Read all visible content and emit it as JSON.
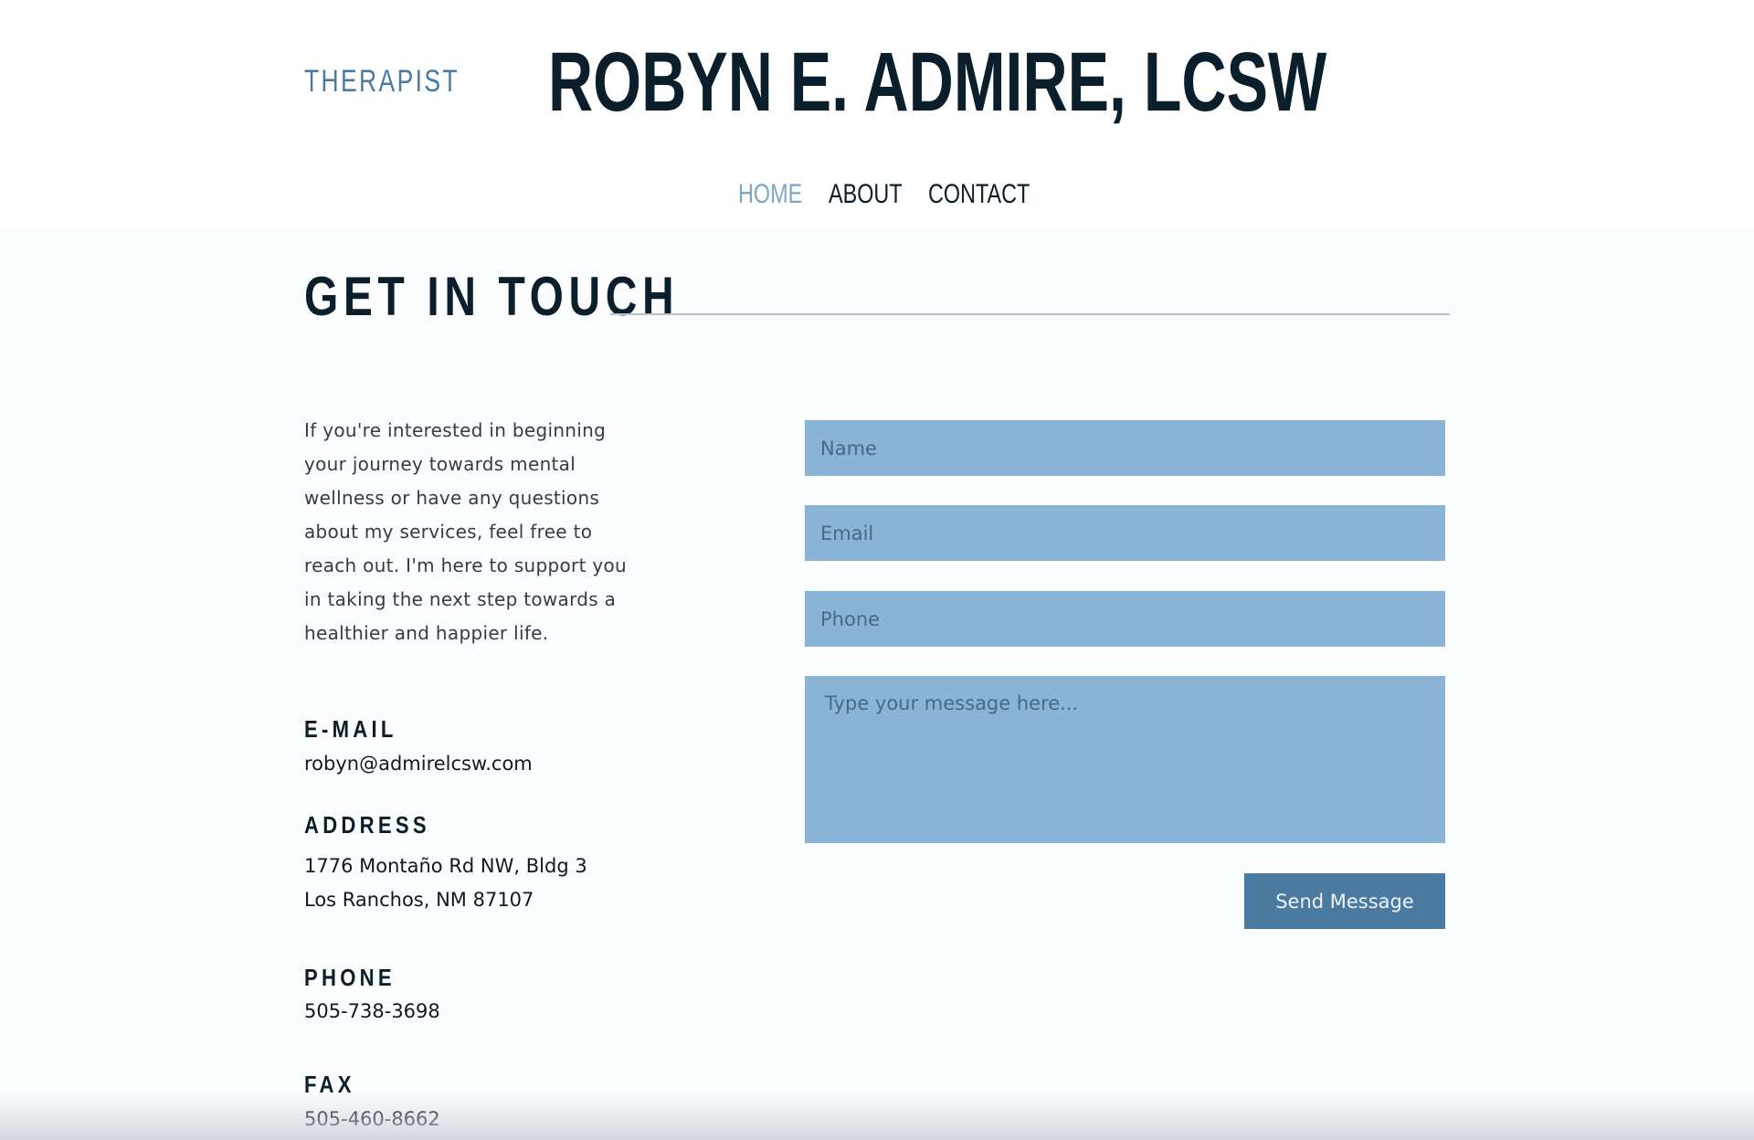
{
  "header": {
    "tagline": "THERAPIST",
    "site_title": "ROBYN E. ADMIRE, LCSW"
  },
  "nav": {
    "items": [
      {
        "label": "HOME",
        "active": true
      },
      {
        "label": "ABOUT",
        "active": false
      },
      {
        "label": "CONTACT",
        "active": false
      }
    ]
  },
  "main": {
    "section_title": "GET IN TOUCH",
    "intro": "If you're interested in beginning your journey towards mental wellness or have any questions about my services, feel free to reach out. I'm here to support you in taking the next step towards a healthier and happier life.",
    "contact_info": {
      "email_label": "E-MAIL",
      "email_value": "robyn@admirelcsw.com",
      "address_label": "ADDRESS",
      "address_line1": "1776 Montaño Rd NW, Bldg 3",
      "address_line2": "Los Ranchos, NM 87107",
      "phone_label": "PHONE",
      "phone_value": "505-738-3698",
      "fax_label": "FAX",
      "fax_value": "505-460-8662"
    },
    "form": {
      "name_placeholder": "Name",
      "name_value": "",
      "email_placeholder": "Email",
      "email_value": "",
      "phone_placeholder": "Phone",
      "phone_value": "",
      "message_placeholder": "Type your message here...",
      "message_value": "",
      "submit_label": "Send Message"
    }
  },
  "colors": {
    "accent": "#4a7aa0",
    "field_bg": "#8ab4d5",
    "nav_active": "#7aa6c8",
    "text_dark": "#0a1f2b",
    "page_bg": "#fcfdfe"
  }
}
